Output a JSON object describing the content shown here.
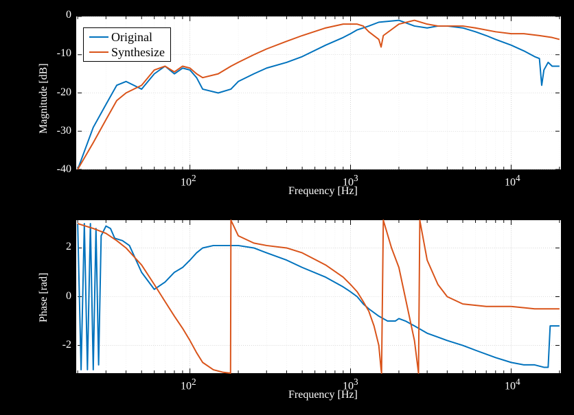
{
  "chart_data": [
    {
      "type": "line",
      "title": "",
      "xlabel": "Frequency [Hz]",
      "ylabel": "Magnitude [dB]",
      "x_scale": "log",
      "xlim": [
        20,
        20000
      ],
      "ylim": [
        -40,
        0
      ],
      "x_ticks": [
        100,
        1000,
        10000
      ],
      "x_tick_labels": [
        "10^2",
        "10^3",
        "10^4"
      ],
      "y_ticks": [
        -40,
        -30,
        -20,
        -10,
        0
      ],
      "legend": [
        "Original",
        "Synthesize"
      ],
      "legend_pos": "upper-left",
      "series": [
        {
          "name": "Original",
          "color": "#0072BD",
          "x": [
            20,
            25,
            30,
            35,
            40,
            50,
            60,
            70,
            80,
            90,
            100,
            110,
            120,
            150,
            180,
            200,
            250,
            300,
            400,
            500,
            700,
            900,
            1000,
            1100,
            1200,
            1300,
            1500,
            2000,
            2500,
            3000,
            3500,
            4000,
            5000,
            6000,
            7000,
            8000,
            10000,
            12000,
            14000,
            15000,
            15500,
            16000,
            17000,
            18000,
            20000
          ],
          "y": [
            -40,
            -29,
            -23,
            -18,
            -17,
            -19,
            -15,
            -13,
            -15,
            -13.5,
            -14,
            -16,
            -19,
            -20,
            -19,
            -17,
            -15,
            -13.5,
            -12,
            -10.5,
            -7.5,
            -5.5,
            -4.5,
            -3.5,
            -3,
            -2.5,
            -1.5,
            -1,
            -2.5,
            -3,
            -2.5,
            -2.5,
            -3,
            -4,
            -5,
            -6,
            -7.5,
            -9,
            -10.5,
            -11,
            -18,
            -14,
            -12,
            -13,
            -13
          ]
        },
        {
          "name": "Synthesize",
          "color": "#D95319",
          "x": [
            20,
            25,
            30,
            35,
            40,
            50,
            60,
            70,
            80,
            90,
            100,
            110,
            120,
            150,
            180,
            200,
            250,
            300,
            400,
            500,
            700,
            900,
            1000,
            1100,
            1200,
            1300,
            1500,
            1550,
            1600,
            2000,
            2500,
            3000,
            3500,
            4000,
            5000,
            6000,
            8000,
            10000,
            12000,
            15000,
            18000,
            20000
          ],
          "y": [
            -40,
            -33,
            -27,
            -22,
            -20,
            -18,
            -14,
            -13,
            -14.5,
            -13,
            -13.5,
            -15,
            -16,
            -15,
            -13,
            -12,
            -10,
            -8.5,
            -6.5,
            -5,
            -3,
            -2,
            -2,
            -2,
            -2.5,
            -4,
            -6,
            -8,
            -5,
            -2,
            -1,
            -2,
            -2.5,
            -2.5,
            -2.5,
            -3,
            -4,
            -4.5,
            -4.5,
            -5,
            -5.5,
            -6
          ]
        }
      ]
    },
    {
      "type": "line",
      "title": "",
      "xlabel": "Frequency [Hz]",
      "ylabel": "Phase [rad]",
      "x_scale": "log",
      "xlim": [
        20,
        20000
      ],
      "ylim": [
        -3.14,
        3.14
      ],
      "x_ticks": [
        100,
        1000,
        10000
      ],
      "x_tick_labels": [
        "10^2",
        "10^3",
        "10^4"
      ],
      "y_ticks": [
        -2,
        0,
        2
      ],
      "series": [
        {
          "name": "Original",
          "color": "#0072BD",
          "x": [
            20,
            21,
            22,
            23,
            24,
            25,
            26,
            27,
            28,
            30,
            32,
            34,
            38,
            42,
            50,
            60,
            70,
            80,
            90,
            100,
            110,
            120,
            140,
            160,
            180,
            200,
            250,
            300,
            400,
            500,
            700,
            900,
            1000,
            1100,
            1200,
            1300,
            1500,
            1700,
            1900,
            2000,
            2200,
            2500,
            3000,
            4000,
            5000,
            6000,
            8000,
            10000,
            12000,
            14000,
            16000,
            17000,
            17500,
            18000,
            20000
          ],
          "y": [
            3.0,
            -3.0,
            3.0,
            -3.0,
            3.0,
            -3.0,
            2.8,
            -2.8,
            2.5,
            2.9,
            2.8,
            2.4,
            2.3,
            2.1,
            1.0,
            0.3,
            0.6,
            1.0,
            1.2,
            1.5,
            1.8,
            2.0,
            2.1,
            2.1,
            2.1,
            2.1,
            2.0,
            1.8,
            1.5,
            1.2,
            0.8,
            0.4,
            0.2,
            0.0,
            -0.3,
            -0.5,
            -0.8,
            -1.0,
            -1.0,
            -0.9,
            -1.0,
            -1.2,
            -1.5,
            -1.8,
            -2.0,
            -2.2,
            -2.5,
            -2.7,
            -2.8,
            -2.8,
            -2.9,
            -2.9,
            -1.2,
            -1.2,
            -1.2
          ]
        },
        {
          "name": "Synthesize",
          "color": "#D95319",
          "x": [
            20,
            25,
            30,
            35,
            40,
            50,
            60,
            70,
            80,
            90,
            100,
            110,
            120,
            140,
            160,
            179,
            180,
            200,
            250,
            300,
            400,
            500,
            700,
            900,
            1000,
            1100,
            1200,
            1300,
            1400,
            1500,
            1550,
            1560,
            1600,
            1800,
            2000,
            2500,
            2600,
            2650,
            2700,
            3000,
            3500,
            4000,
            5000,
            7000,
            10000,
            14000,
            20000
          ],
          "y": [
            3.0,
            2.8,
            2.6,
            2.3,
            2.0,
            1.3,
            0.5,
            -0.2,
            -0.8,
            -1.3,
            -1.8,
            -2.3,
            -2.7,
            -3.0,
            -3.1,
            -3.14,
            3.14,
            2.5,
            2.2,
            2.1,
            2.0,
            1.8,
            1.3,
            0.8,
            0.5,
            0.2,
            -0.2,
            -0.6,
            -1.2,
            -2.0,
            -3.0,
            -3.14,
            3.14,
            2.0,
            1.2,
            -1.8,
            -2.7,
            -3.14,
            3.14,
            1.5,
            0.5,
            0.0,
            -0.3,
            -0.4,
            -0.4,
            -0.5,
            -0.5
          ]
        }
      ]
    }
  ],
  "colors": {
    "original": "#0072BD",
    "synthesize": "#D95319",
    "grid": "#e0e0e0",
    "minor_grid": "#f0f0f0"
  },
  "labels": {
    "legend_original": "Original",
    "legend_synthesize": "Synthesize",
    "xlabel_top": "Frequency [Hz]",
    "ylabel_top": "Magnitude [dB]",
    "xlabel_bottom": "Frequency [Hz]",
    "ylabel_bottom": "Phase [rad]"
  }
}
